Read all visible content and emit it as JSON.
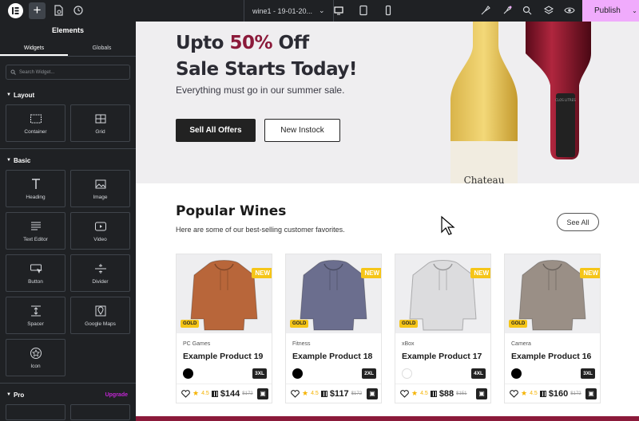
{
  "topbar": {
    "doc_title": "wine1 - 19-01-20...",
    "publish_label": "Publish"
  },
  "sidebar": {
    "title": "Elements",
    "tabs": [
      "Widgets",
      "Globals"
    ],
    "search_placeholder": "Search Widget...",
    "categories": {
      "layout": "Layout",
      "basic": "Basic",
      "pro": "Pro",
      "pro_link": "Upgrade"
    },
    "layout_widgets": [
      "Container",
      "Grid"
    ],
    "basic_widgets": [
      "Heading",
      "Image",
      "Text Editor",
      "Video",
      "Button",
      "Divider",
      "Spacer",
      "Google Maps",
      "Icon"
    ]
  },
  "hero": {
    "line1_pre": "Upto ",
    "line1_red": "50%",
    "line1_post": " Off",
    "line2": "Sale Starts Today!",
    "subtitle": "Everything must go in our summer sale.",
    "btn_primary": "Sell All Offers",
    "btn_secondary": "New Instock",
    "bottle_label": "Chateau",
    "bottle_top_label": "CLOS LITRES"
  },
  "popular": {
    "title": "Popular Wines",
    "subtitle": "Here are some of our best-selling customer favorites.",
    "see_all": "See All"
  },
  "products": [
    {
      "category": "PC Games",
      "name": "Example Product 19",
      "badge_new": "NEW",
      "badge_gold": "GOLD",
      "size": "3XL",
      "rating": "4.5",
      "price": "$144",
      "old_price": "$172",
      "swatch": "black",
      "hoodie_color": "#b8663a"
    },
    {
      "category": "Fitness",
      "name": "Example Product 18",
      "badge_new": "NEW",
      "badge_gold": "GOLD",
      "size": "2XL",
      "rating": "4.5",
      "price": "$117",
      "old_price": "$172",
      "swatch": "black",
      "hoodie_color": "#6b6e8e"
    },
    {
      "category": "xBox",
      "name": "Example Product 17",
      "badge_new": "NEW",
      "badge_gold": "GOLD",
      "size": "4XL",
      "rating": "4.5",
      "price": "$88",
      "old_price": "$151",
      "swatch": "white",
      "hoodie_color": "#dcdcde"
    },
    {
      "category": "Camera",
      "name": "Example Product 16",
      "badge_new": "NEW",
      "badge_gold": "GOLD",
      "size": "3XL",
      "rating": "4.5",
      "price": "$160",
      "old_price": "$172",
      "swatch": "black",
      "hoodie_color": "#9a8f86"
    }
  ],
  "colors": {
    "accent": "#8b1a3a",
    "publish_bg": "#f0abfc",
    "badge_yellow": "#f5c518",
    "editor_dark": "#1f2124"
  }
}
